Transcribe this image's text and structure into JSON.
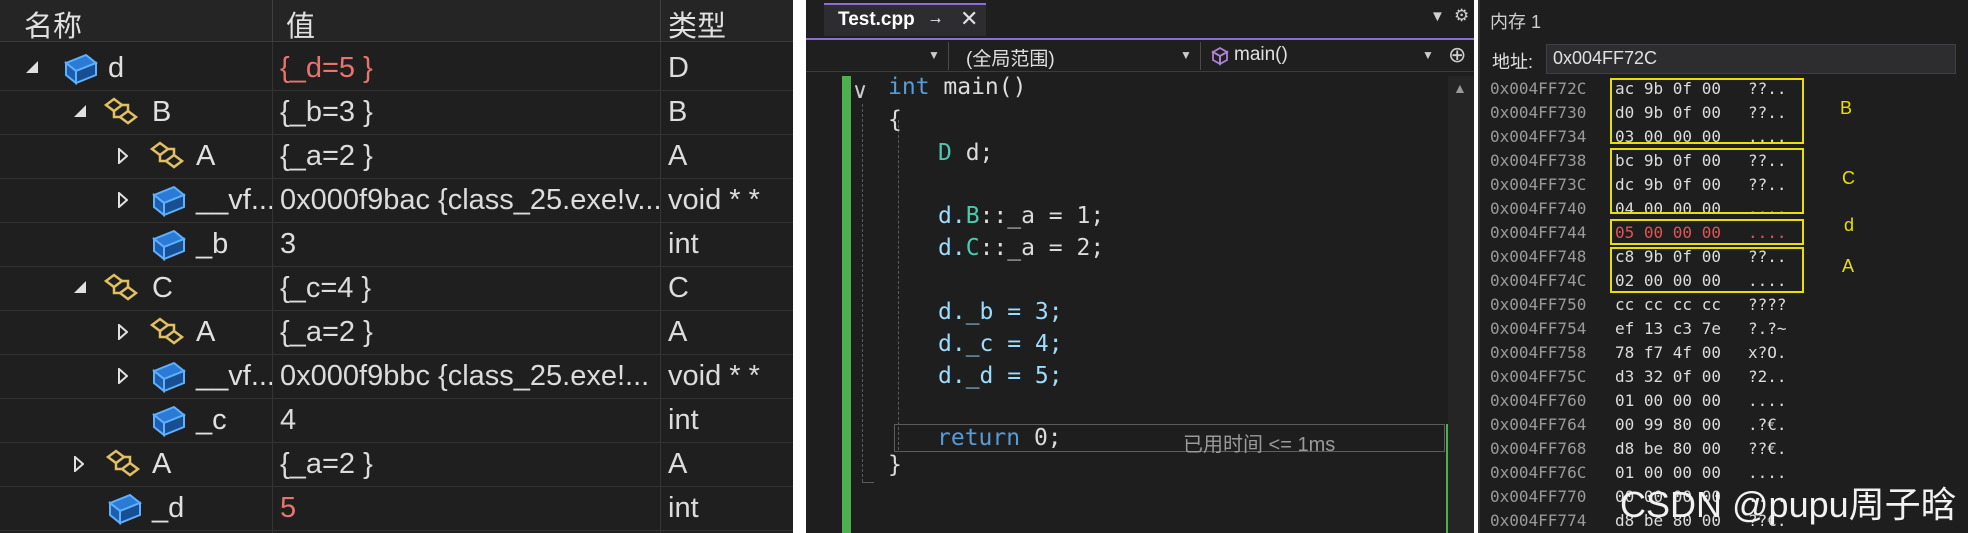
{
  "watch": {
    "columns": {
      "name": "名称",
      "value": "值",
      "type": "类型"
    },
    "rows": [
      {
        "name": "d",
        "value": "{_d=5 }",
        "type": "D",
        "value_changed": true
      },
      {
        "name": "B",
        "value": "{_b=3 }",
        "type": "B"
      },
      {
        "name": "A",
        "value": "{_a=2 }",
        "type": "A"
      },
      {
        "name": "__vf...",
        "value": "0x000f9bac {class_25.exe!v...",
        "type": "void * *"
      },
      {
        "name": "_b",
        "value": "3",
        "type": "int"
      },
      {
        "name": "C",
        "value": "{_c=4 }",
        "type": "C"
      },
      {
        "name": "A",
        "value": "{_a=2 }",
        "type": "A"
      },
      {
        "name": "__vf...",
        "value": "0x000f9bbc {class_25.exe!...",
        "type": "void * *"
      },
      {
        "name": "_c",
        "value": "4",
        "type": "int"
      },
      {
        "name": "A",
        "value": "{_a=2 }",
        "type": "A"
      },
      {
        "name": "_d",
        "value": "5",
        "type": "int",
        "value_changed": true
      }
    ]
  },
  "editor": {
    "tab_title": "Test.cpp",
    "scope_selector": "(全局范围)",
    "function_selector": "main()",
    "code": {
      "l1_kw": "int",
      "l1_fn": " main()",
      "l2": "{",
      "l3_type": "D",
      "l3_rest": " d;",
      "l4_var": "d.",
      "l4_type": "B",
      "l4_rest": "::_a = 1;",
      "l5_var": "d.",
      "l5_type": "C",
      "l5_rest": "::_a = 2;",
      "l6": "d._b = 3;",
      "l7": "d._c = 4;",
      "l8": "d._d = 5;",
      "l9_kw": "return",
      "l9_rest": " 0;",
      "l10": "}"
    },
    "elapsed_label": "已用时间 <= 1ms"
  },
  "memory": {
    "title": "内存 1",
    "address_label": "地址:",
    "address_value": "0x004FF72C",
    "rows": [
      {
        "addr": "0x004FF72C",
        "hex": "ac 9b 0f 00",
        "ascii": "??.."
      },
      {
        "addr": "0x004FF730",
        "hex": "d0 9b 0f 00",
        "ascii": "??.."
      },
      {
        "addr": "0x004FF734",
        "hex": "03 00 00 00",
        "ascii": "...."
      },
      {
        "addr": "0x004FF738",
        "hex": "bc 9b 0f 00",
        "ascii": "??.."
      },
      {
        "addr": "0x004FF73C",
        "hex": "dc 9b 0f 00",
        "ascii": "??.."
      },
      {
        "addr": "0x004FF740",
        "hex": "04 00 00 00",
        "ascii": "...."
      },
      {
        "addr": "0x004FF744",
        "hex": "05 00 00 00",
        "ascii": "....",
        "changed": true
      },
      {
        "addr": "0x004FF748",
        "hex": "c8 9b 0f 00",
        "ascii": "??.."
      },
      {
        "addr": "0x004FF74C",
        "hex": "02 00 00 00",
        "ascii": "...."
      },
      {
        "addr": "0x004FF750",
        "hex": "cc cc cc cc",
        "ascii": "????"
      },
      {
        "addr": "0x004FF754",
        "hex": "ef 13 c3 7e",
        "ascii": "?.?~"
      },
      {
        "addr": "0x004FF758",
        "hex": "78 f7 4f 00",
        "ascii": "x?O."
      },
      {
        "addr": "0x004FF75C",
        "hex": "d3 32 0f 00",
        "ascii": "?2.."
      },
      {
        "addr": "0x004FF760",
        "hex": "01 00 00 00",
        "ascii": "...."
      },
      {
        "addr": "0x004FF764",
        "hex": "00 99 80 00",
        "ascii": ".?€."
      },
      {
        "addr": "0x004FF768",
        "hex": "d8 be 80 00",
        "ascii": "??€."
      },
      {
        "addr": "0x004FF76C",
        "hex": "01 00 00 00",
        "ascii": "...."
      },
      {
        "addr": "0x004FF770",
        "hex": "00 00 00 00",
        "ascii": "...."
      },
      {
        "addr": "0x004FF774",
        "hex": "d8 be 80 00",
        "ascii": "??€."
      }
    ],
    "annotations": {
      "b": "B",
      "c": "C",
      "d": "d",
      "a": "A"
    },
    "annotation_color": "#e8e000"
  },
  "watermark": "CSDN @pupu周子晗",
  "colors": {
    "accent": "#8f6bd6",
    "changed_value": "#e8746e",
    "green_margin": "#4caf50"
  }
}
